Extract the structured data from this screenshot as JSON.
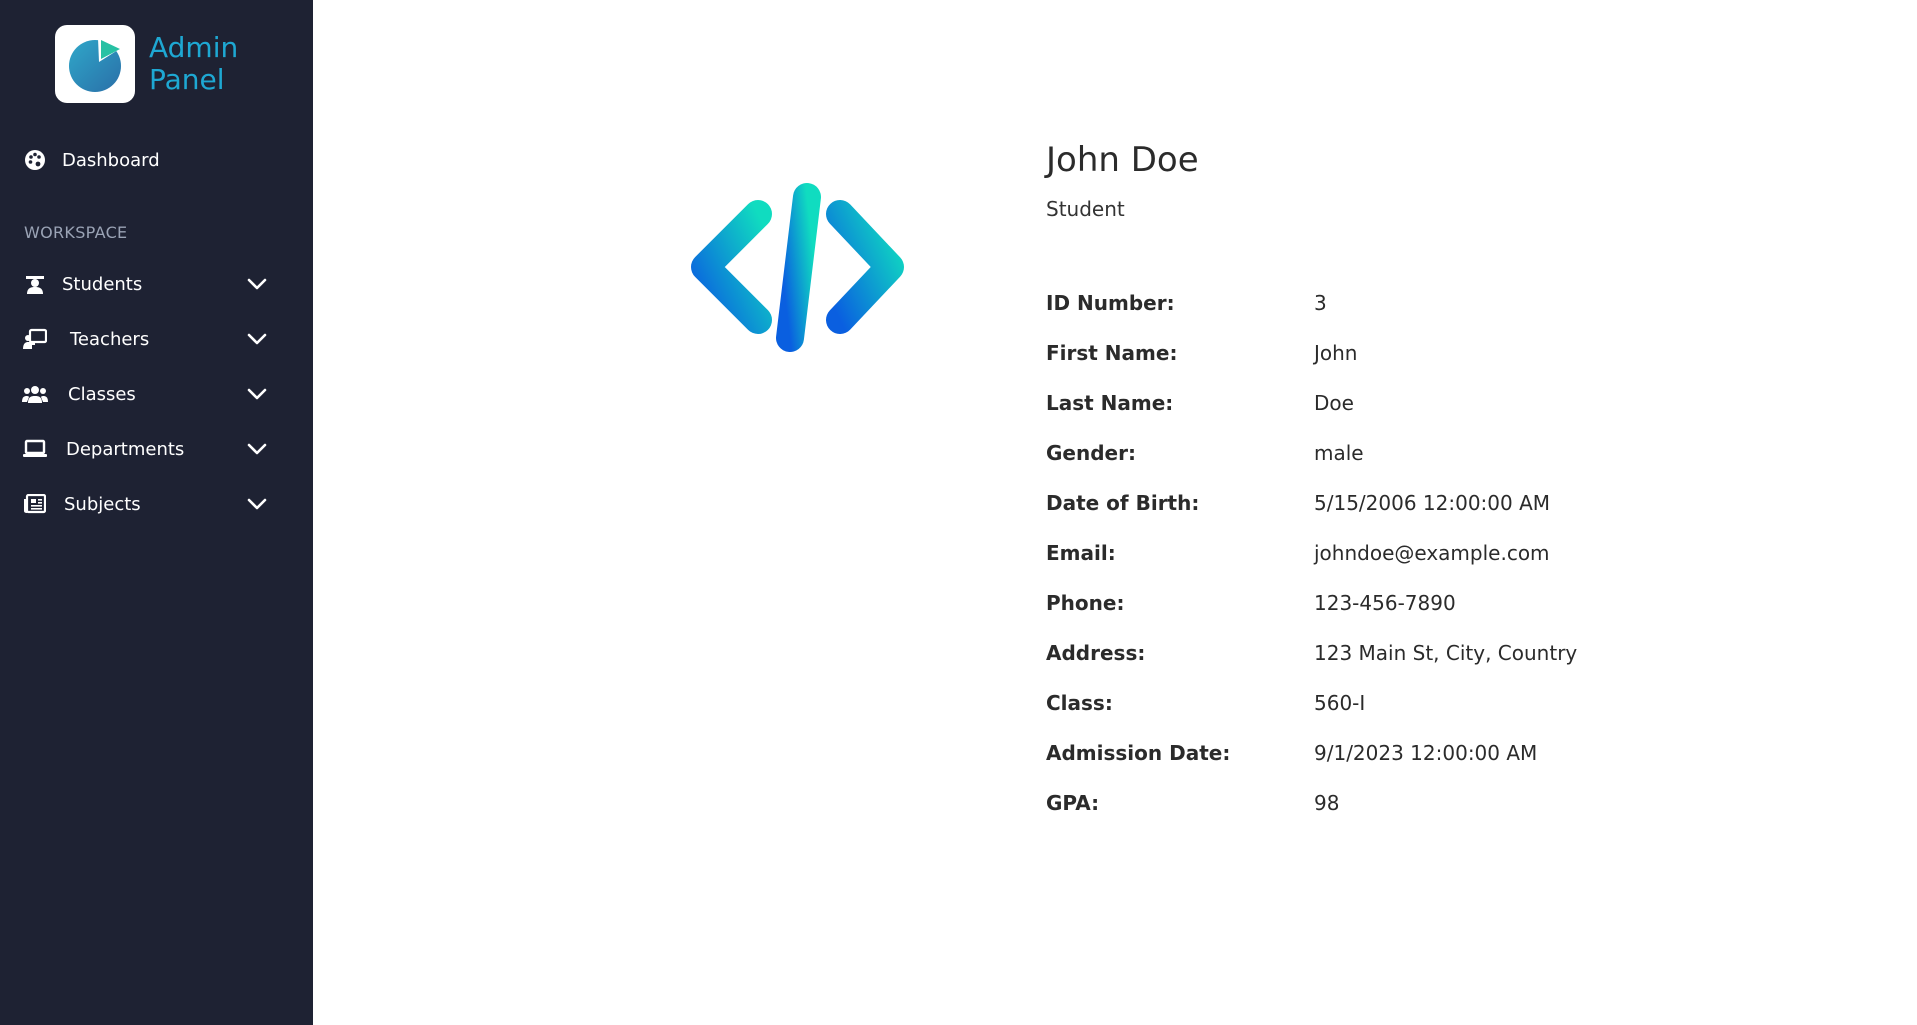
{
  "brand": {
    "title_line1": "Admin",
    "title_line2": "Panel"
  },
  "sidebar": {
    "dashboard_label": "Dashboard",
    "section_label": "WORKSPACE",
    "items": [
      {
        "label": "Students",
        "icon": "student-icon"
      },
      {
        "label": "Teachers",
        "icon": "teacher-board-icon"
      },
      {
        "label": "Classes",
        "icon": "users-group-icon"
      },
      {
        "label": "Departments",
        "icon": "laptop-icon"
      },
      {
        "label": "Subjects",
        "icon": "newspaper-icon"
      }
    ]
  },
  "profile": {
    "name": "John Doe",
    "role": "Student",
    "details": [
      {
        "label": "ID Number:",
        "value": "3"
      },
      {
        "label": "First Name:",
        "value": "John"
      },
      {
        "label": "Last Name:",
        "value": "Doe"
      },
      {
        "label": "Gender:",
        "value": "male"
      },
      {
        "label": "Date of Birth:",
        "value": "5/15/2006 12:00:00 AM"
      },
      {
        "label": "Email:",
        "value": "johndoe@example.com"
      },
      {
        "label": "Phone:",
        "value": "123-456-7890"
      },
      {
        "label": "Address:",
        "value": "123 Main St, City, Country"
      },
      {
        "label": "Class:",
        "value": "560-I"
      },
      {
        "label": "Admission Date:",
        "value": "9/1/2023 12:00:00 AM"
      },
      {
        "label": "GPA:",
        "value": "98"
      }
    ]
  },
  "colors": {
    "sidebar_bg": "#1e2233",
    "brand_accent": "#1ea8d3",
    "code_gradient_start": "#0a5fe0",
    "code_gradient_end": "#10dcc0"
  }
}
